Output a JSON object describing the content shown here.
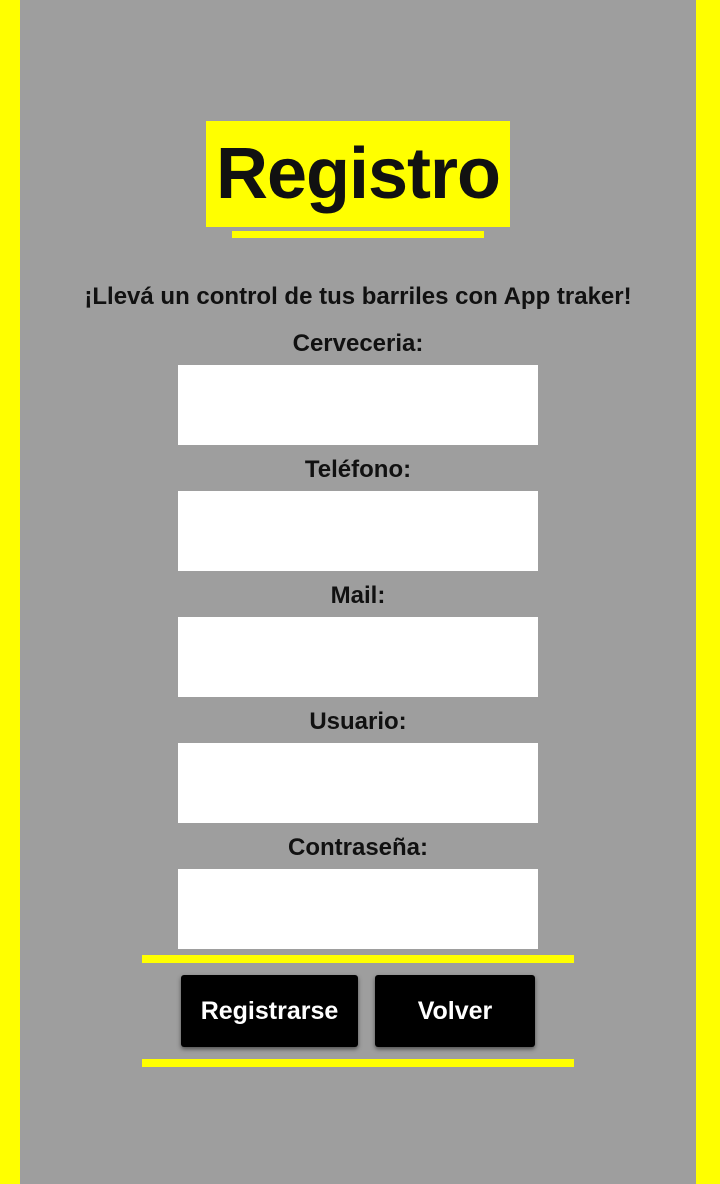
{
  "theme": {
    "accent": "#ffff00",
    "background": "#9e9e9e",
    "button": "#000000"
  },
  "header": {
    "title": "Registro"
  },
  "tagline": "¡Llevá un control de tus barriles con App traker!",
  "form": {
    "fields": [
      {
        "label": "Cerveceria:",
        "value": "",
        "placeholder": ""
      },
      {
        "label": "Teléfono:",
        "value": "",
        "placeholder": ""
      },
      {
        "label": "Mail:",
        "value": "",
        "placeholder": ""
      },
      {
        "label": "Usuario:",
        "value": "",
        "placeholder": ""
      },
      {
        "label": "Contraseña:",
        "value": "",
        "placeholder": ""
      }
    ]
  },
  "actions": {
    "register_label": "Registrarse",
    "back_label": "Volver"
  }
}
